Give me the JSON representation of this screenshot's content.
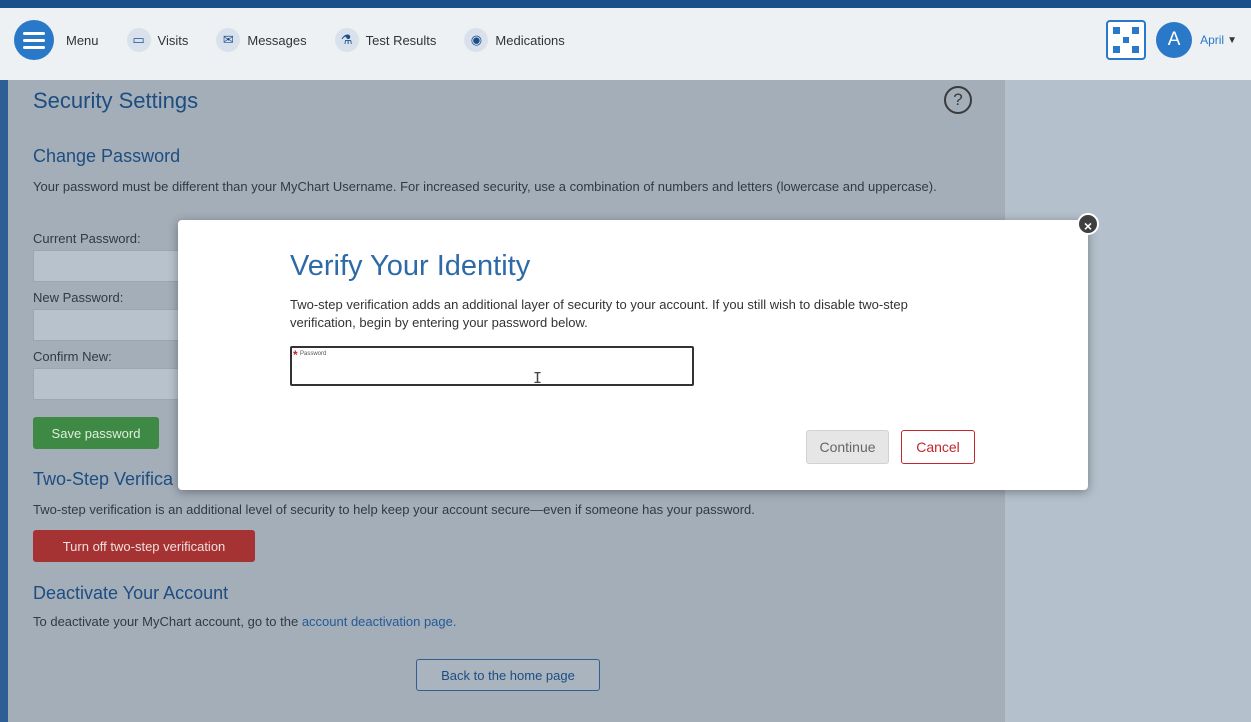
{
  "nav": {
    "menu_label": "Menu",
    "items": [
      {
        "label": "Visits",
        "icon": "calendar-icon"
      },
      {
        "label": "Messages",
        "icon": "envelope-icon"
      },
      {
        "label": "Test Results",
        "icon": "flask-icon"
      },
      {
        "label": "Medications",
        "icon": "pills-icon"
      }
    ],
    "user_initial": "A",
    "user_name": "April"
  },
  "page": {
    "title": "Security Settings",
    "help_symbol": "?",
    "change_password": {
      "heading": "Change Password",
      "description": "Your password must be different than your MyChart Username. For increased security, use a combination of numbers and letters (lowercase and uppercase).",
      "current_label": "Current Password:",
      "new_label": "New Password:",
      "confirm_label": "Confirm New:",
      "save_label": "Save password"
    },
    "two_step": {
      "heading": "Two-Step Verifica",
      "description": "Two-step verification is an additional level of security to help keep your account secure—even if someone has your password.",
      "turn_off_label": "Turn off two-step verification"
    },
    "deactivate": {
      "heading": "Deactivate Your Account",
      "text_prefix": "To deactivate your MyChart account, go to the ",
      "link_text": "account deactivation page."
    },
    "back_label": "Back to the home page"
  },
  "modal": {
    "close_symbol": "×",
    "title": "Verify Your Identity",
    "text": "Two-step verification adds an additional layer of security to your account. If you still wish to disable two-step verification, begin by entering your password below.",
    "password_required_mark": "*",
    "password_label": "Password",
    "password_value": "",
    "continue_label": "Continue",
    "cancel_label": "Cancel"
  },
  "colors": {
    "brand_blue": "#2a78c8",
    "heading_blue": "#1e4d80",
    "danger_red": "#c2262e",
    "success_green": "#3e8a44"
  }
}
